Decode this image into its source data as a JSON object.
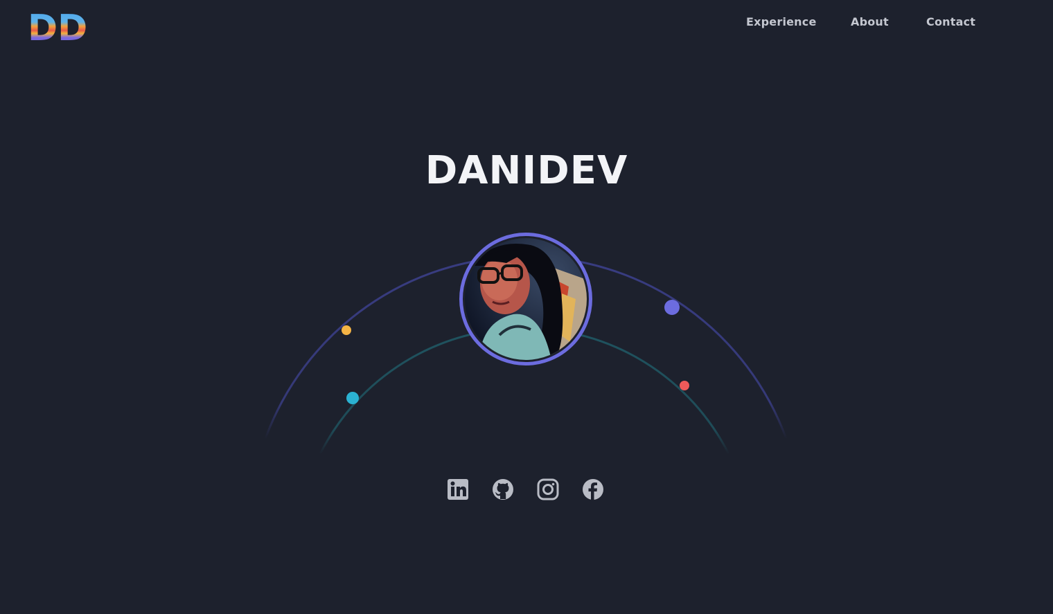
{
  "header": {
    "logo_text": "DD",
    "nav": {
      "experience": "Experience",
      "about": "About",
      "contact": "Contact"
    }
  },
  "hero": {
    "title": "DANIDEV",
    "avatar_alt": "profile photo"
  },
  "socials": [
    {
      "icon": "linkedin-icon"
    },
    {
      "icon": "github-icon"
    },
    {
      "icon": "instagram-icon"
    },
    {
      "icon": "facebook-icon"
    }
  ],
  "colors": {
    "background": "#1d212d",
    "accent": "#6c6cdf",
    "orbit_outer": "#3b3f8a",
    "orbit_inner": "#1f5662",
    "dot_yellow": "#f5b445",
    "dot_cyan": "#2bb2d2",
    "dot_purple": "#6c6cdf",
    "dot_red": "#f05a5a",
    "icon": "#b9bcc5"
  }
}
